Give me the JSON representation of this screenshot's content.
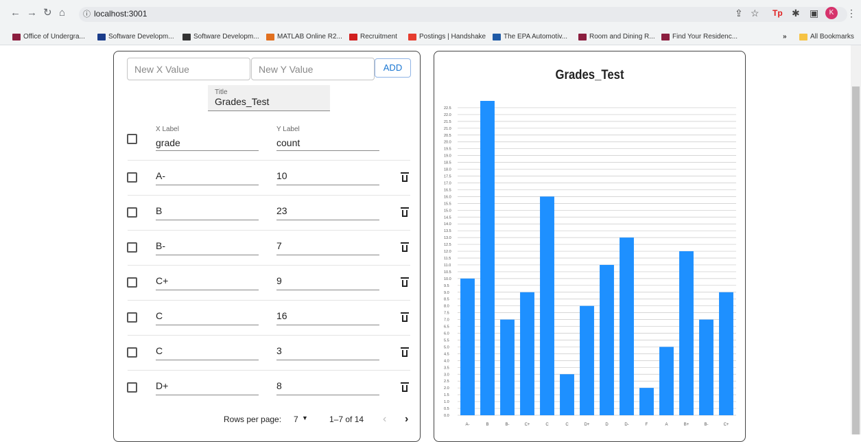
{
  "browser": {
    "url": "localhost:3001",
    "profile_initial": "K",
    "bookmarks_overflow": "»",
    "all_bookmarks": "All Bookmarks",
    "bookmarks": [
      {
        "label": "Office of Undergra...",
        "color": "#8b1e3f"
      },
      {
        "label": "Software Developm...",
        "color": "#1a3c8a"
      },
      {
        "label": "Software Developm...",
        "color": "#333333"
      },
      {
        "label": "MATLAB Online R2...",
        "color": "#e1701f"
      },
      {
        "label": "Recruitment",
        "color": "#d11f1f"
      },
      {
        "label": "Postings | Handshake",
        "color": "#e63d2f"
      },
      {
        "label": "The EPA Automotiv...",
        "color": "#1f5aa6"
      },
      {
        "label": "Room and Dining R...",
        "color": "#8b1e3f"
      },
      {
        "label": "Find Your Residenc...",
        "color": "#8b1e3f"
      }
    ]
  },
  "form": {
    "x_placeholder": "New X Value",
    "y_placeholder": "New Y Value",
    "add_label": "ADD",
    "title_label": "Title",
    "title_value": "Grades_Test",
    "x_label_caption": "X Label",
    "x_label_value": "grade",
    "y_label_caption": "Y Label",
    "y_label_value": "count"
  },
  "rows": [
    {
      "x": "A-",
      "y": "10"
    },
    {
      "x": "B",
      "y": "23"
    },
    {
      "x": "B-",
      "y": "7"
    },
    {
      "x": "C+",
      "y": "9"
    },
    {
      "x": "C",
      "y": "16"
    },
    {
      "x": "C",
      "y": "3"
    },
    {
      "x": "D+",
      "y": "8"
    }
  ],
  "pager": {
    "rows_per_page_label": "Rows per page:",
    "rows_per_page": "7",
    "range": "1–7 of 14"
  },
  "chart_data": {
    "type": "bar",
    "title": "Grades_Test",
    "categories": [
      "A-",
      "B",
      "B-",
      "C+",
      "C",
      "C",
      "D+",
      "D",
      "D-",
      "F",
      "A",
      "B+",
      "B-",
      "C+"
    ],
    "values": [
      10,
      23,
      7,
      9,
      16,
      3,
      8,
      11,
      13,
      2,
      5,
      12,
      7,
      9
    ],
    "ylim": [
      0,
      23
    ],
    "ytick_step": 0.5,
    "grid": "horizontal",
    "color": "#1e90ff"
  }
}
